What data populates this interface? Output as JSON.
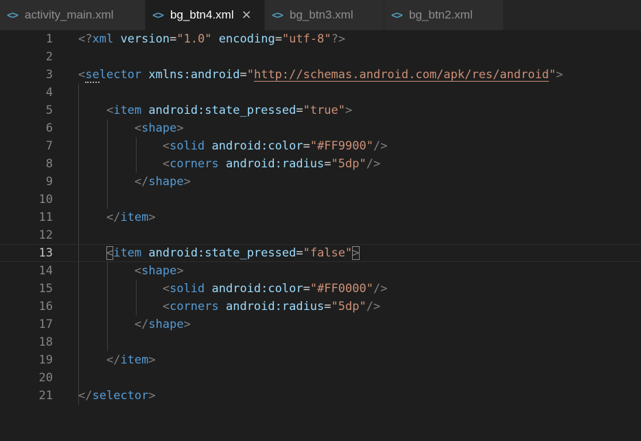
{
  "tabs": [
    {
      "icon": "<>",
      "label": "activity_main.xml",
      "active": false
    },
    {
      "icon": "<>",
      "label": "bg_btn4.xml",
      "active": true,
      "close": "×"
    },
    {
      "icon": "<>",
      "label": "bg_btn3.xml",
      "active": false
    },
    {
      "icon": "<>",
      "label": "bg_btn2.xml",
      "active": false
    }
  ],
  "editor": {
    "current_line": 13,
    "lines": [
      {
        "n": "1",
        "tokens": [
          [
            "tg",
            "<?"
          ],
          [
            "tn",
            "xml"
          ],
          [
            "eq",
            " "
          ],
          [
            "at",
            "version"
          ],
          [
            "eq",
            "="
          ],
          [
            "st",
            "\"1.0\""
          ],
          [
            "eq",
            " "
          ],
          [
            "at",
            "encoding"
          ],
          [
            "eq",
            "="
          ],
          [
            "st",
            "\"utf-8\""
          ],
          [
            "tg",
            "?>"
          ]
        ]
      },
      {
        "n": "2",
        "tokens": []
      },
      {
        "n": "3",
        "tokens": [
          [
            "tg",
            "<"
          ],
          [
            "tn",
            "selector"
          ],
          [
            "eq",
            " "
          ],
          [
            "at",
            "xmlns:android"
          ],
          [
            "eq",
            "="
          ],
          [
            "st",
            "\""
          ],
          [
            "url",
            "http://schemas.android.com/apk/res/android"
          ],
          [
            "st",
            "\""
          ],
          [
            "tg",
            ">"
          ]
        ]
      },
      {
        "n": "4",
        "tokens": []
      },
      {
        "n": "5",
        "tokens": [
          [
            "eq",
            "    "
          ],
          [
            "tg",
            "<"
          ],
          [
            "tn",
            "item"
          ],
          [
            "eq",
            " "
          ],
          [
            "at",
            "android:state_pressed"
          ],
          [
            "eq",
            "="
          ],
          [
            "st",
            "\"true\""
          ],
          [
            "tg",
            ">"
          ]
        ]
      },
      {
        "n": "6",
        "tokens": [
          [
            "eq",
            "        "
          ],
          [
            "tg",
            "<"
          ],
          [
            "tn",
            "shape"
          ],
          [
            "tg",
            ">"
          ]
        ]
      },
      {
        "n": "7",
        "tokens": [
          [
            "eq",
            "            "
          ],
          [
            "tg",
            "<"
          ],
          [
            "tn",
            "solid"
          ],
          [
            "eq",
            " "
          ],
          [
            "at",
            "android:color"
          ],
          [
            "eq",
            "="
          ],
          [
            "st",
            "\"#FF9900\""
          ],
          [
            "tg",
            "/>"
          ]
        ]
      },
      {
        "n": "8",
        "tokens": [
          [
            "eq",
            "            "
          ],
          [
            "tg",
            "<"
          ],
          [
            "tn",
            "corners"
          ],
          [
            "eq",
            " "
          ],
          [
            "at",
            "android:radius"
          ],
          [
            "eq",
            "="
          ],
          [
            "st",
            "\"5dp\""
          ],
          [
            "tg",
            "/>"
          ]
        ]
      },
      {
        "n": "9",
        "tokens": [
          [
            "eq",
            "        "
          ],
          [
            "tg",
            "</"
          ],
          [
            "tn",
            "shape"
          ],
          [
            "tg",
            ">"
          ]
        ]
      },
      {
        "n": "10",
        "tokens": []
      },
      {
        "n": "11",
        "tokens": [
          [
            "eq",
            "    "
          ],
          [
            "tg",
            "</"
          ],
          [
            "tn",
            "item"
          ],
          [
            "tg",
            ">"
          ]
        ]
      },
      {
        "n": "12",
        "tokens": []
      },
      {
        "n": "13",
        "tokens": [
          [
            "eq",
            "    "
          ],
          [
            "tg",
            "<"
          ],
          [
            "tn",
            "item"
          ],
          [
            "eq",
            " "
          ],
          [
            "at",
            "android:state_pressed"
          ],
          [
            "eq",
            "="
          ],
          [
            "st",
            "\"false\""
          ],
          [
            "tg",
            ">"
          ]
        ]
      },
      {
        "n": "14",
        "tokens": [
          [
            "eq",
            "        "
          ],
          [
            "tg",
            "<"
          ],
          [
            "tn",
            "shape"
          ],
          [
            "tg",
            ">"
          ]
        ]
      },
      {
        "n": "15",
        "tokens": [
          [
            "eq",
            "            "
          ],
          [
            "tg",
            "<"
          ],
          [
            "tn",
            "solid"
          ],
          [
            "eq",
            " "
          ],
          [
            "at",
            "android:color"
          ],
          [
            "eq",
            "="
          ],
          [
            "st",
            "\"#FF0000\""
          ],
          [
            "tg",
            "/>"
          ]
        ]
      },
      {
        "n": "16",
        "tokens": [
          [
            "eq",
            "            "
          ],
          [
            "tg",
            "<"
          ],
          [
            "tn",
            "corners"
          ],
          [
            "eq",
            " "
          ],
          [
            "at",
            "android:radius"
          ],
          [
            "eq",
            "="
          ],
          [
            "st",
            "\"5dp\""
          ],
          [
            "tg",
            "/>"
          ]
        ]
      },
      {
        "n": "17",
        "tokens": [
          [
            "eq",
            "        "
          ],
          [
            "tg",
            "</"
          ],
          [
            "tn",
            "shape"
          ],
          [
            "tg",
            ">"
          ]
        ]
      },
      {
        "n": "18",
        "tokens": []
      },
      {
        "n": "19",
        "tokens": [
          [
            "eq",
            "    "
          ],
          [
            "tg",
            "</"
          ],
          [
            "tn",
            "item"
          ],
          [
            "tg",
            ">"
          ]
        ]
      },
      {
        "n": "20",
        "tokens": []
      },
      {
        "n": "21",
        "tokens": [
          [
            "tg",
            "</"
          ],
          [
            "tn",
            "selector"
          ],
          [
            "tg",
            ">"
          ]
        ]
      }
    ]
  }
}
